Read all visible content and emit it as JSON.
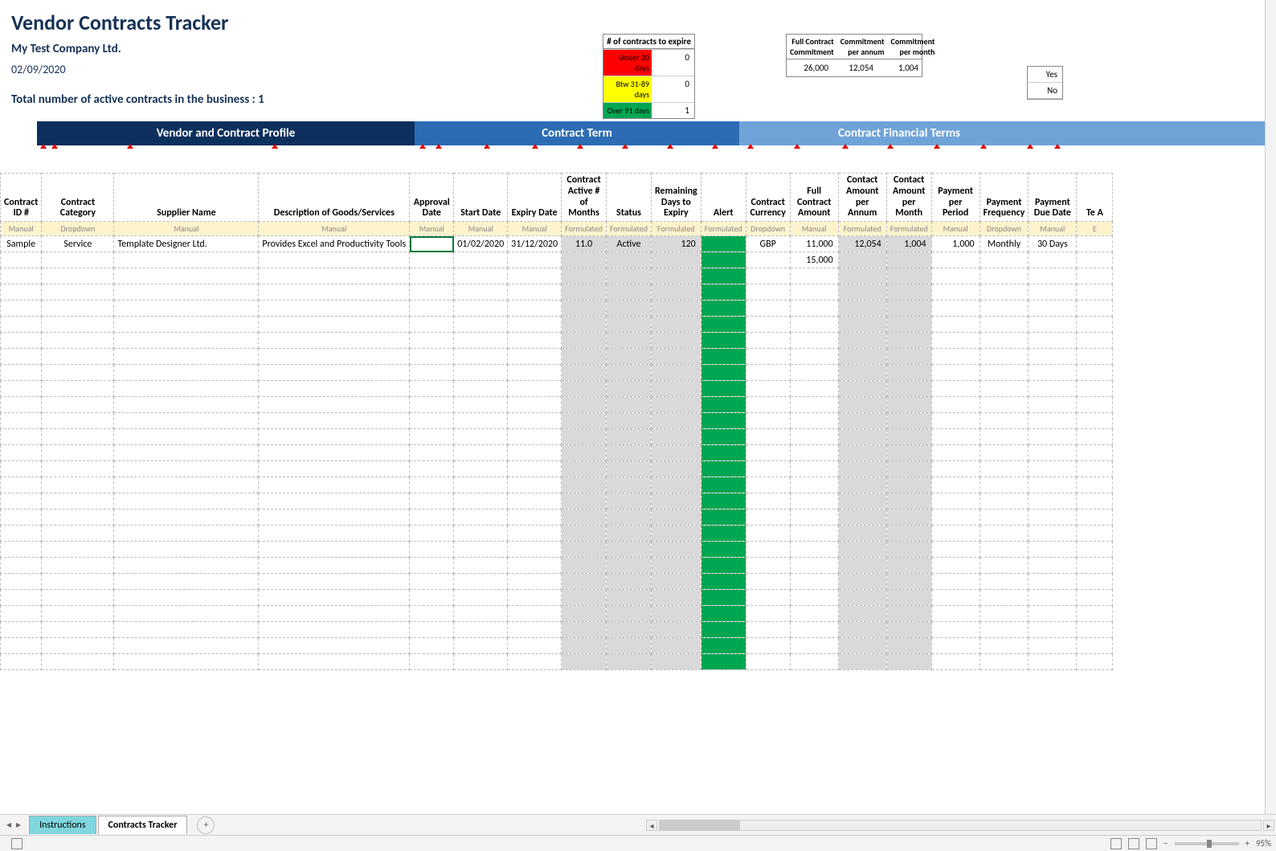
{
  "title": "Vendor Contracts Tracker",
  "company": "My Test Company Ltd.",
  "date": "02/09/2020",
  "total_line_prefix": "Total number of active contracts in the business : ",
  "total_count": "1",
  "legend": {
    "header": "# of contracts to expire",
    "rows": [
      {
        "label": "Under 30 days",
        "value": "0",
        "class": "lr-red"
      },
      {
        "label": "Btw 31-89 days",
        "value": "0",
        "class": "lr-yellow"
      },
      {
        "label": "Over 91 days",
        "value": "1",
        "class": "lr-green"
      }
    ]
  },
  "commitment": {
    "headers": [
      "Full Contract Commitment",
      "Commitment per annum",
      "Commitment per month"
    ],
    "values": [
      "26,000",
      "12,054",
      "1,004"
    ]
  },
  "yesno": [
    "Yes",
    "No"
  ],
  "sections": [
    {
      "label": "Vendor and Contract Profile"
    },
    {
      "label": "Contract Term"
    },
    {
      "label": "Contract Financial Terms"
    }
  ],
  "columns": [
    {
      "header": "Contract ID #",
      "type": "Manual",
      "w": "col-id"
    },
    {
      "header": "Contract Category",
      "type": "Dropdown",
      "w": "col-cat"
    },
    {
      "header": "Supplier Name",
      "type": "Manual",
      "w": "col-sup"
    },
    {
      "header": "Description of Goods/Services",
      "type": "Manual",
      "w": "col-desc"
    },
    {
      "header": "Approval Date",
      "type": "Manual",
      "w": "col-app"
    },
    {
      "header": "Start Date",
      "type": "Manual",
      "w": "col-std"
    },
    {
      "header": "Expiry Date",
      "type": "Manual",
      "w": "col-std"
    },
    {
      "header": "Contract Active # of Months",
      "type": "Formulated",
      "w": "col-mid",
      "grey": true
    },
    {
      "header": "Status",
      "type": "Formulated",
      "w": "col-mid",
      "grey": true
    },
    {
      "header": "Remaining Days to Expiry",
      "type": "Formulated",
      "w": "col-mid",
      "grey": true
    },
    {
      "header": "Alert",
      "type": "Formulated",
      "w": "col-mid",
      "green": true
    },
    {
      "header": "Contract Currency",
      "type": "Dropdown",
      "w": "col-mid"
    },
    {
      "header": "Full Contract Amount",
      "type": "Manual",
      "w": "col-std"
    },
    {
      "header": "Contact Amount per Annum",
      "type": "Formulated",
      "w": "col-std",
      "grey": true
    },
    {
      "header": "Contact Amount per Month",
      "type": "Formulated",
      "w": "col-mid",
      "grey": true
    },
    {
      "header": "Payment per Period",
      "type": "Manual",
      "w": "col-std"
    },
    {
      "header": "Payment Frequency",
      "type": "Dropdown",
      "w": "col-std"
    },
    {
      "header": "Payment Due Date",
      "type": "Manual",
      "w": "col-std"
    },
    {
      "header": "Te A",
      "type": "E",
      "w": "col-narrow"
    }
  ],
  "rows": [
    {
      "cells": [
        "Sample",
        "Service",
        "Template Designer Ltd.",
        "Provides Excel and Productivity Tools",
        "",
        "01/02/2020",
        "31/12/2020",
        "11.0",
        "Active",
        "120",
        "",
        "GBP",
        "11,000",
        "12,054",
        "1,004",
        "1,000",
        "Monthly",
        "30 Days",
        ""
      ],
      "align": [
        "c",
        "c",
        "l",
        "l",
        "c",
        "c",
        "c",
        "c",
        "c",
        "r",
        "c",
        "c",
        "r",
        "r",
        "r",
        "r",
        "c",
        "c",
        "c"
      ]
    },
    {
      "cells": [
        "",
        "",
        "",
        "",
        "",
        "",
        "",
        "",
        "",
        "",
        "",
        "",
        "15,000",
        "",
        "",
        "",
        "",
        "",
        ""
      ],
      "align": [
        "c",
        "c",
        "l",
        "l",
        "c",
        "c",
        "c",
        "c",
        "c",
        "r",
        "c",
        "c",
        "r",
        "r",
        "r",
        "r",
        "c",
        "c",
        "c"
      ]
    }
  ],
  "empty_rows": 25,
  "tabs": [
    {
      "label": "Instructions",
      "active": false
    },
    {
      "label": "Contracts Tracker",
      "active": true
    }
  ],
  "statusbar": {
    "zoom": "95%"
  },
  "selected": {
    "row": 0,
    "col": 4
  }
}
